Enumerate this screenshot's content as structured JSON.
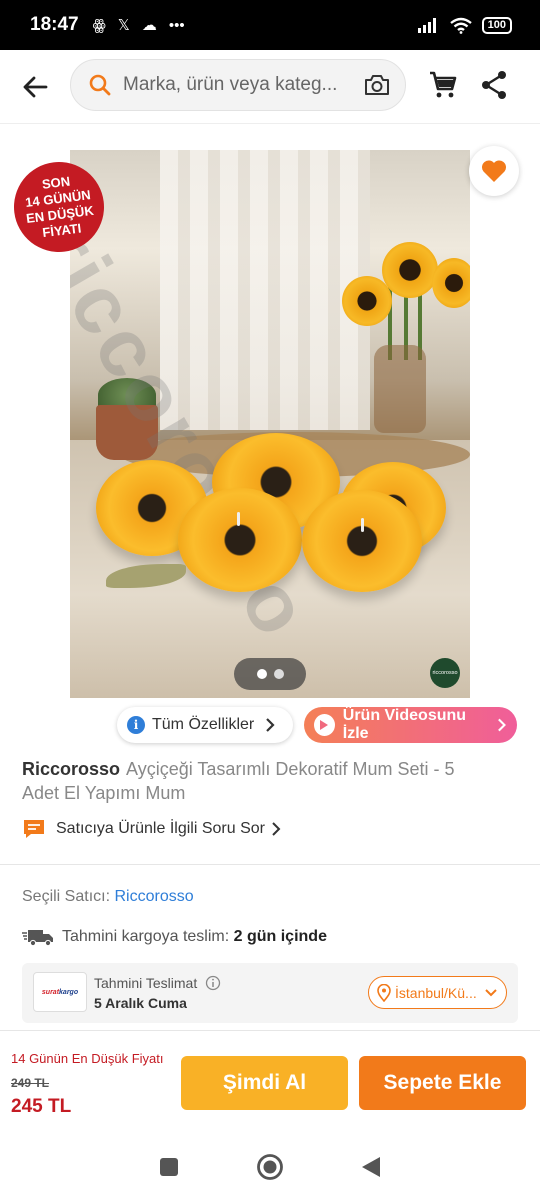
{
  "status_bar": {
    "time": "18:47",
    "left_icons": [
      "ꙮ",
      "𝕏",
      "☁",
      "•••"
    ],
    "battery": "100"
  },
  "header": {
    "search_placeholder": "Marka, ürün veya kateg..."
  },
  "image": {
    "badge_lines": [
      "SON",
      "14 GÜNÜN",
      "EN DÜŞÜK",
      "FİYATI"
    ],
    "watermark": "riccorosso",
    "logo_text": "riccorosso",
    "slide_count": 2,
    "active_slide": 1
  },
  "chips": {
    "features": "Tüm Özellikler",
    "video": "Ürün Videosunu İzle"
  },
  "product": {
    "brand": "Riccorosso",
    "name": "Ayçiçeği Tasarımlı Dekoratif Mum Seti - 5 Adet El Yapımı Mum",
    "ask_seller": "Satıcıya Ürünle İlgili Soru Sor"
  },
  "seller": {
    "label": "Seçili Satıcı:",
    "name": "Riccorosso"
  },
  "delivery": {
    "text": "Tahmini kargoya teslim:",
    "days": "2 gün içinde"
  },
  "delivery_box": {
    "carrier_logo_a": "surat",
    "carrier_logo_b": "kargo",
    "label": "Tahmini Teslimat",
    "date": "5 Aralık Cuma",
    "city": "İstanbul/Kü..."
  },
  "bottom": {
    "promo": "14 Günün En Düşük Fiyatı",
    "old_price": "249 TL",
    "price": "245 TL",
    "buy_now": "Şimdi Al",
    "add_to_cart": "Sepete Ekle"
  },
  "colors": {
    "brand_orange": "#f27a1a",
    "buy_yellow": "#f9b126",
    "promo_red": "#c41b23",
    "link_blue": "#2f7ed8"
  }
}
